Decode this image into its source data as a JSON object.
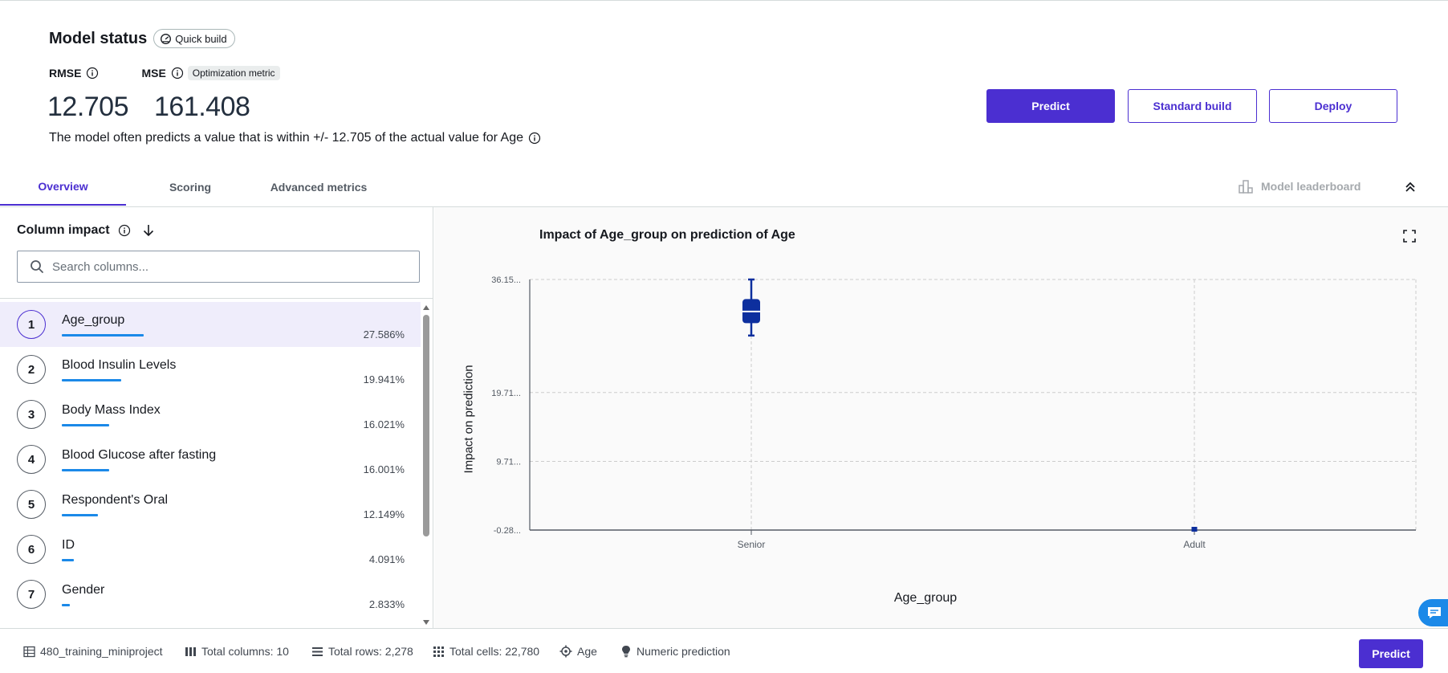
{
  "header": {
    "title": "Model status",
    "build_chip": "Quick build",
    "metrics": [
      {
        "label": "RMSE",
        "value": "12.705"
      },
      {
        "label": "MSE",
        "value": "161.408",
        "chip": "Optimization metric"
      }
    ],
    "description": "The model often predicts a value that is within +/- 12.705 of the actual value for Age"
  },
  "actions": {
    "predict": "Predict",
    "standard_build": "Standard build",
    "deploy": "Deploy"
  },
  "tabs": [
    {
      "label": "Overview",
      "active": true
    },
    {
      "label": "Scoring",
      "active": false
    },
    {
      "label": "Advanced metrics",
      "active": false
    }
  ],
  "leaderboard_label": "Model leaderboard",
  "column_impact": {
    "title": "Column impact",
    "search_placeholder": "Search columns...",
    "items": [
      {
        "rank": "1",
        "name": "Age_group",
        "pct": "27.586%",
        "share": 27.586,
        "selected": true
      },
      {
        "rank": "2",
        "name": "Blood Insulin Levels",
        "pct": "19.941%",
        "share": 19.941,
        "selected": false
      },
      {
        "rank": "3",
        "name": "Body Mass Index",
        "pct": "16.021%",
        "share": 16.021,
        "selected": false
      },
      {
        "rank": "4",
        "name": "Blood Glucose after fasting",
        "pct": "16.001%",
        "share": 16.001,
        "selected": false
      },
      {
        "rank": "5",
        "name": "Respondent's Oral",
        "pct": "12.149%",
        "share": 12.149,
        "selected": false
      },
      {
        "rank": "6",
        "name": "ID",
        "pct": "4.091%",
        "share": 4.091,
        "selected": false
      },
      {
        "rank": "7",
        "name": "Gender",
        "pct": "2.833%",
        "share": 2.833,
        "selected": false
      }
    ]
  },
  "chart_data": {
    "type": "box",
    "title": "Impact of Age_group on prediction of Age",
    "xlabel": "Age_group",
    "ylabel": "Impact on prediction",
    "categories": [
      "Senior",
      "Adult"
    ],
    "y_ticks": [
      {
        "label": "36.15...",
        "value": 36.15
      },
      {
        "label": "19.71...",
        "value": 19.71
      },
      {
        "label": "9.71...",
        "value": 9.71
      },
      {
        "label": "-0.28...",
        "value": -0.28
      }
    ],
    "ylim": [
      -0.28,
      36.15
    ],
    "grid": true,
    "boxes": [
      {
        "category": "Senior",
        "min": 28.0,
        "q1": 29.8,
        "median": 31.5,
        "q3": 33.3,
        "max": 36.15
      },
      {
        "category": "Adult",
        "min": -0.28,
        "q1": -0.28,
        "median": -0.28,
        "q3": -0.28,
        "max": -0.28
      }
    ]
  },
  "footer": {
    "dataset": "480_training_miniproject",
    "columns": "Total columns: 10",
    "rows": "Total rows: 2,278",
    "cells": "Total cells: 22,780",
    "target": "Age",
    "problem_type": "Numeric prediction",
    "predict": "Predict"
  },
  "colors": {
    "accent": "#4b2fd1",
    "bar": "#1b89e8",
    "box": "#0d2f9e"
  }
}
